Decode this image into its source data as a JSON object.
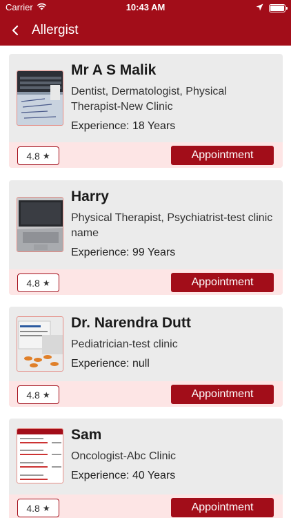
{
  "status_bar": {
    "carrier": "Carrier",
    "time": "10:43 AM",
    "icons": [
      "wifi-icon",
      "location-arrow-icon",
      "battery-icon"
    ]
  },
  "nav": {
    "back_icon": "chevron-left-icon",
    "title": "Allergist"
  },
  "colors": {
    "primary": "#a20d19",
    "card_bg": "#ebebeb",
    "footer_bg": "#fde5e5",
    "thumb_border": "#e58b84"
  },
  "doctors": [
    {
      "name": "Mr A S Malik",
      "specialty": " Dentist, Dermatologist, Physical Therapist-New Clinic",
      "experience": "Experience: 18 Years",
      "rating": "4.8",
      "action": "Appointment"
    },
    {
      "name": "Harry",
      "specialty": " Physical Therapist, Psychiatrist-test clinic name",
      "experience": "Experience: 99 Years",
      "rating": "4.8",
      "action": "Appointment"
    },
    {
      "name": "Dr. Narendra Dutt",
      "specialty": " Pediatrician-test clinic",
      "experience": "Experience: null",
      "rating": "4.8",
      "action": "Appointment"
    },
    {
      "name": "Sam",
      "specialty": " Oncologist-Abc Clinic",
      "experience": "Experience: 40 Years",
      "rating": "4.8",
      "action": "Appointment"
    }
  ]
}
